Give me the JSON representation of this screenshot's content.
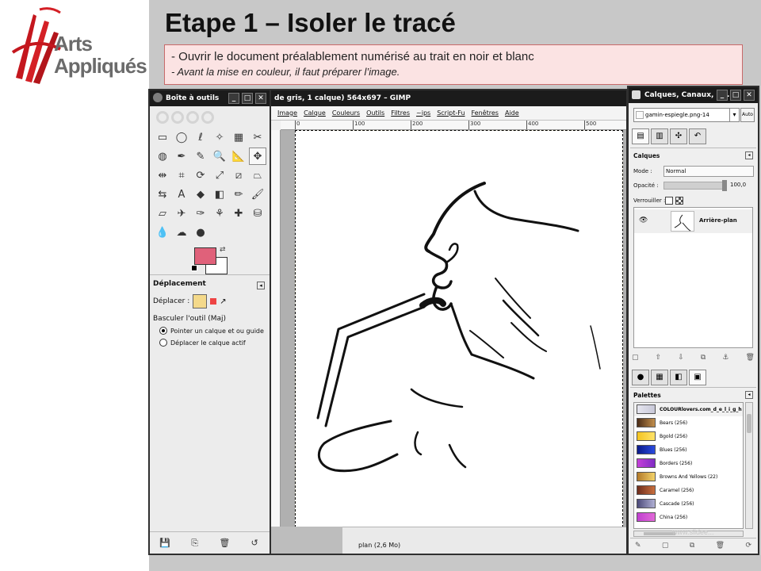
{
  "slide": {
    "logo_arts": "Arts",
    "logo_appliques": "Appliqués",
    "title": "Etape 1 – Isoler le tracé",
    "subtitle_line1": "- Ouvrir le document préalablement numérisé au trait en noir et blanc",
    "subtitle_line2": "- Avant la mise en couleur, il faut préparer l’image."
  },
  "toolbox": {
    "title": "Boîte à outils",
    "fg_color": "#e0617a",
    "bg_color": "#ffffff",
    "tools": [
      "rect-select-icon",
      "ellipse-select-icon",
      "free-select-icon",
      "fuzzy-select-icon",
      "color-select-icon",
      "scissors-icon",
      "foreground-select-icon",
      "paths-icon",
      "color-picker-icon",
      "zoom-icon",
      "measure-icon",
      "move-icon",
      "align-icon",
      "crop-icon",
      "rotate-icon",
      "scale-icon",
      "shear-icon",
      "perspective-icon",
      "flip-icon",
      "text-icon",
      "bucket-fill-icon",
      "blend-icon",
      "pencil-icon",
      "paintbrush-icon",
      "eraser-icon",
      "airbrush-icon",
      "ink-icon",
      "clone-icon",
      "heal-icon",
      "perspective-clone-icon",
      "blur-icon",
      "smudge-icon",
      "dodge-burn-icon"
    ],
    "tool_glyphs": [
      "▭",
      "◯",
      "ℓ",
      "✧",
      "▦",
      "✂",
      "◍",
      "✒",
      "✎",
      "🔍",
      "📐",
      "✥",
      "⇹",
      "⌗",
      "⟳",
      "⤢",
      "⧄",
      "⏢",
      "⇆",
      "A",
      "◆",
      "◧",
      "✏",
      "🖌",
      "▱",
      "✈",
      "✑",
      "⚘",
      "✚",
      "⛁",
      "💧",
      "☁",
      "●"
    ],
    "active_tool_index": 11,
    "options": {
      "title": "Déplacement",
      "move_label": "Déplacer :",
      "toggle_label": "Basculer l'outil  (Maj)",
      "radio1": "Pointer un calque et ou guide",
      "radio2": "Déplacer le calque actif"
    }
  },
  "image_window": {
    "title": "de gris, 1 calque) 564x697 – GIMP",
    "menu": [
      "Image",
      "Calque",
      "Couleurs",
      "Outils",
      "Filtres",
      "~ips",
      "Script-Fu",
      "Fenêtres",
      "Aide"
    ],
    "ruler_ticks": [
      "0",
      "100",
      "200",
      "300",
      "400",
      "500"
    ],
    "status": "plan (2,6 Mo)"
  },
  "dock": {
    "title": "Calques, Canaux, C...",
    "image_select": "gamin-espiegle.png-14",
    "auto_label": "Auto",
    "layers_title": "Calques",
    "mode_label": "Mode :",
    "mode_value": "Normal",
    "opacity_label": "Opacité :",
    "opacity_value": "100,0",
    "opacity": 1.0,
    "lock_label": "Verrouiller :",
    "layer_name": "Arrière-plan",
    "palettes_title": "Palettes",
    "palettes": [
      {
        "name": "COLOURlovers.com_d_e_l_i_g_h",
        "colors": [
          "#e6e6ef",
          "#c8c8d8"
        ]
      },
      {
        "name": "Bears (256)",
        "colors": [
          "#4a2c17",
          "#c28f4c"
        ]
      },
      {
        "name": "Bgold (256)",
        "colors": [
          "#f4c420",
          "#ffe36a"
        ]
      },
      {
        "name": "Blues (256)",
        "colors": [
          "#0a1a8a",
          "#2b4ce0"
        ]
      },
      {
        "name": "Borders (256)",
        "colors": [
          "#c43fd8",
          "#7f2cc4"
        ]
      },
      {
        "name": "Browns And Yellows (22)",
        "colors": [
          "#b37a2a",
          "#f3d36a"
        ]
      },
      {
        "name": "Caramel (256)",
        "colors": [
          "#6e2d1c",
          "#c96f3e"
        ]
      },
      {
        "name": "Cascade (256)",
        "colors": [
          "#4c4a7a",
          "#b0b0d4"
        ]
      },
      {
        "name": "China (256)",
        "colors": [
          "#c03fd0",
          "#e26ad8"
        ]
      }
    ]
  },
  "watermark": "www.slidee..."
}
